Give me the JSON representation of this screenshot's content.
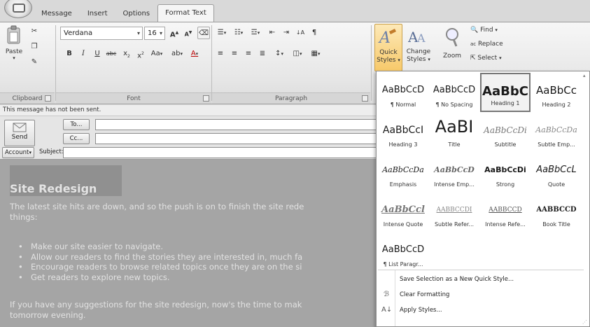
{
  "tabs": [
    {
      "label": "Message",
      "active": false
    },
    {
      "label": "Insert",
      "active": false
    },
    {
      "label": "Options",
      "active": false
    },
    {
      "label": "Format Text",
      "active": true
    }
  ],
  "ribbon": {
    "clipboard": {
      "paste_label": "Paste",
      "group_label": "Clipboard"
    },
    "font": {
      "family": "Verdana",
      "size": "16",
      "group_label": "Font"
    },
    "paragraph": {
      "group_label": "Paragraph"
    },
    "styles": {
      "quick_styles_line1": "Quick",
      "quick_styles_line2": "Styles",
      "change_styles_line1": "Change",
      "change_styles_line2": "Styles"
    },
    "zoom": {
      "label": "Zoom"
    },
    "editing": {
      "find": "Find",
      "replace": "Replace",
      "select": "Select"
    }
  },
  "infobar": {
    "text": "This message has not been sent."
  },
  "header": {
    "send": "Send",
    "to": "To...",
    "cc": "Cc...",
    "account": "Account",
    "subject_label": "Subject:"
  },
  "body": {
    "title": "Site Redesign",
    "para1_line1": "The latest site hits are down, and so the push is on to finish the site rede",
    "para1_line2": "things:",
    "bullets": [
      "Make our site easier to navigate.",
      "Allow our readers to find the stories they are interested in, much fa",
      "Encourage readers to browse related topics once they are on the si",
      "Get readers to explore new topics."
    ],
    "para2_line1": "If you have any suggestions for the site redesign, now's the time to mak",
    "para2_line2": "tomorrow evening."
  },
  "gallery": {
    "styles": [
      {
        "sample": "AaBbCcD",
        "label": "¶ Normal"
      },
      {
        "sample": "AaBbCcD",
        "label": "¶ No Spacing"
      },
      {
        "sample": "AaBbC",
        "label": "Heading 1",
        "selected": true
      },
      {
        "sample": "AaBbCc",
        "label": "Heading 2"
      },
      {
        "sample": "AaBbCcI",
        "label": "Heading 3"
      },
      {
        "sample": "AaBI",
        "label": "Title"
      },
      {
        "sample": "AaBbCcDi",
        "label": "Subtitle"
      },
      {
        "sample": "AaBbCcDa",
        "label": "Subtle Emp..."
      },
      {
        "sample": "AaBbCcDa",
        "label": "Emphasis"
      },
      {
        "sample": "AaBbCcD",
        "label": "Intense Emp..."
      },
      {
        "sample": "AaBbCcDi",
        "label": "Strong"
      },
      {
        "sample": "AaBbCcL",
        "label": "Quote"
      },
      {
        "sample": "AaBbCcl",
        "label": "Intense Quote"
      },
      {
        "sample": "AABBCCDI",
        "label": "Subtle Refer..."
      },
      {
        "sample": "AABBCCD",
        "label": "Intense Refe..."
      },
      {
        "sample": "AABBCCD",
        "label": "Book Title"
      },
      {
        "sample": "AaBbCcD",
        "label": "¶ List Paragr..."
      }
    ],
    "menu": [
      {
        "label": "Save Selection as a New Quick Style...",
        "icon": "save-style-icon"
      },
      {
        "label": "Clear Formatting",
        "icon": "clear-formatting-icon"
      },
      {
        "label": "Apply Styles...",
        "icon": "apply-styles-icon"
      }
    ]
  },
  "colors": {
    "body_bg": "#a5a5a5",
    "ribbon_bg": "#e8e8e8",
    "selected_border": "#777777"
  }
}
